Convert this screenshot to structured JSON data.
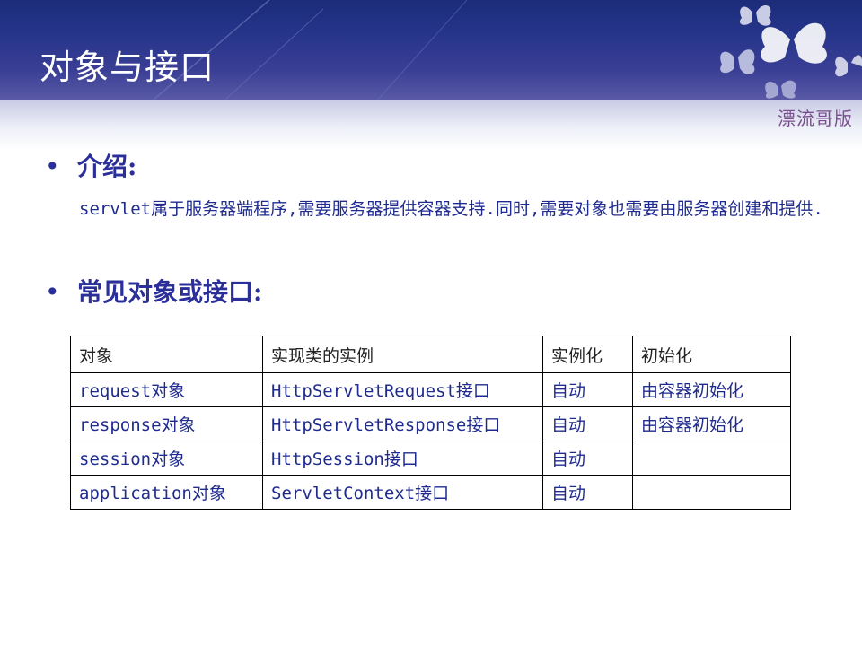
{
  "slide": {
    "title": "对象与接口",
    "watermark": "漂流哥版"
  },
  "section_intro": {
    "bullet": "•",
    "heading": "介绍:",
    "body": "servlet属于服务器端程序,需要服务器提供容器支持.同时,需要对象也需要由服务器创建和提供."
  },
  "section_objects": {
    "bullet": "•",
    "heading": "常见对象或接口:"
  },
  "table": {
    "headers": [
      "对象",
      "实现类的实例",
      "实例化",
      "初始化"
    ],
    "rows": [
      [
        "request对象",
        "HttpServletRequest接口",
        "自动",
        "由容器初始化"
      ],
      [
        "response对象",
        "HttpServletResponse接口",
        "自动",
        "由容器初始化"
      ],
      [
        "session对象",
        "HttpSession接口",
        "自动",
        ""
      ],
      [
        "application对象",
        "ServletContext接口",
        "自动",
        ""
      ]
    ]
  },
  "colors": {
    "header_band": "#26358a",
    "heading_text": "#2b2f9a",
    "body_text": "#1f2b8f",
    "watermark": "#7a4f8e"
  },
  "icons": [
    "butterfly-icon"
  ]
}
